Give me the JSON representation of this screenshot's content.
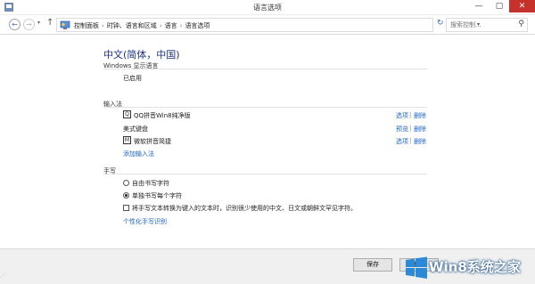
{
  "window": {
    "title": "语言选项",
    "min_glyph": "—",
    "max_glyph": "▢",
    "close_glyph": "✕",
    "accent": "#c7312b"
  },
  "address": {
    "back_glyph": "←",
    "forward_glyph": "→",
    "up_glyph": "↑",
    "breadcrumbs": [
      "控制面板",
      "时钟、语言和区域",
      "语言",
      "语言选项"
    ],
    "separator": "›",
    "refresh_glyph": "↻",
    "search_placeholder": "搜索控制...",
    "search_glyph": "⚲"
  },
  "language": {
    "name": "中文(简体，中国)"
  },
  "display_language": {
    "heading": "Windows 显示语言",
    "status": "已启用"
  },
  "input_methods": {
    "heading": "输入法",
    "items": [
      {
        "name": "QQ拼音Win8纯净版",
        "icon": "qq-pinyin-icon",
        "icon_text": "Q",
        "link1": "选项",
        "link2": "删除"
      },
      {
        "name": "美式键盘",
        "icon": "",
        "icon_text": "",
        "link1": "预览",
        "link2": "删除"
      },
      {
        "name": "微软拼音简捷",
        "icon": "ms-pinyin-icon",
        "icon_text": "M",
        "link1": "选项",
        "link2": "删除"
      }
    ],
    "add_label": "添加输入法"
  },
  "handwriting": {
    "heading": "手写",
    "options": [
      {
        "label": "自由书写字符",
        "selected": false
      },
      {
        "label": "单独书写每个字符",
        "selected": true
      }
    ],
    "checkbox_label": "将手写文本转换为键入的文本时，识别很少使用的中文、日文或朝鲜文罕见字符。",
    "checkbox_checked": false,
    "personalize_link": "个性化手写识别"
  },
  "footer": {
    "save_label": "保存",
    "cancel_label": "取消"
  },
  "watermark": {
    "text": "Win8系统之家",
    "color": "#1b4f86"
  },
  "colors": {
    "link": "#1a64c5",
    "heading": "#1e3287"
  }
}
